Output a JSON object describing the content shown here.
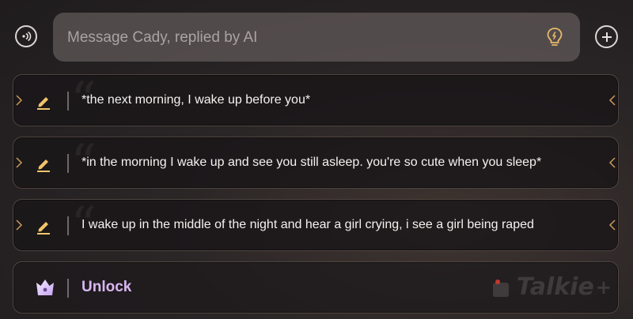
{
  "composer": {
    "placeholder": "Message Cady, replied by AI",
    "voice_icon": "voice-wave-icon",
    "hint_icon": "lightbulb-icon",
    "add_icon": "plus-icon"
  },
  "suggestions": [
    {
      "text": "*the next morning, I wake up before you*"
    },
    {
      "text": "*in the morning I wake up and see you still asleep. you're so cute when you sleep*"
    },
    {
      "text": "I wake up in the middle of the night and hear a girl crying, i see a girl being raped"
    }
  ],
  "unlock": {
    "label": "Unlock",
    "icon": "crown-icon"
  },
  "watermark": {
    "text": "Talkie"
  },
  "colors": {
    "accent_gold": "#f2c46a",
    "unlock_purple": "#d9b6f0",
    "card_bg": "#1a1618"
  }
}
